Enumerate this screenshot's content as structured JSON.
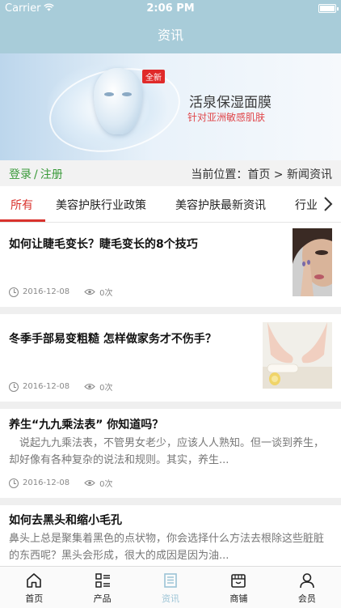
{
  "status_bar": {
    "carrier": "Carrier",
    "time": "2:06 PM"
  },
  "nav": {
    "title": "资讯"
  },
  "banner": {
    "badge": "全新",
    "title": "活泉保湿面膜",
    "subtitle": "针对亚洲敏感肌肤"
  },
  "crumb": {
    "login": "登录",
    "sep": "/",
    "register": "注册",
    "location": "当前位置：首页 > 新闻资讯"
  },
  "tabs": [
    "所有",
    "美容护肤行业政策",
    "美容护肤最新资讯",
    "行业"
  ],
  "articles": [
    {
      "title": "如何让睫毛变长？睫毛变长的8个技巧",
      "date": "2016-12-08",
      "views": "0次"
    },
    {
      "title": "冬季手部易变粗糙 怎样做家务才不伤手？",
      "date": "2016-12-08",
      "views": "0次"
    },
    {
      "title": "养生“九九乘法表” 你知道吗？",
      "excerpt": "　说起九九乘法表，不管男女老少，应该人人熟知。但一谈到养生，却好像有各种复杂的说法和规则。其实，养生...",
      "date": "2016-12-08",
      "views": "0次"
    },
    {
      "title": "如何去黑头和缩小毛孔",
      "excerpt": "鼻头上总是聚集着黑色的点状物，你会选择什么方法去根除这些脏脏的东西呢？黑头会形成，很大的成因是因为油..."
    }
  ],
  "tabbar": [
    {
      "label": "首页",
      "icon": "home-icon"
    },
    {
      "label": "产品",
      "icon": "list-icon"
    },
    {
      "label": "资讯",
      "icon": "news-icon"
    },
    {
      "label": "商铺",
      "icon": "shop-icon"
    },
    {
      "label": "会员",
      "icon": "user-icon"
    }
  ],
  "colors": {
    "theme": "#a8ccd9",
    "accent": "#d9322d",
    "login": "#3a9a3a"
  }
}
